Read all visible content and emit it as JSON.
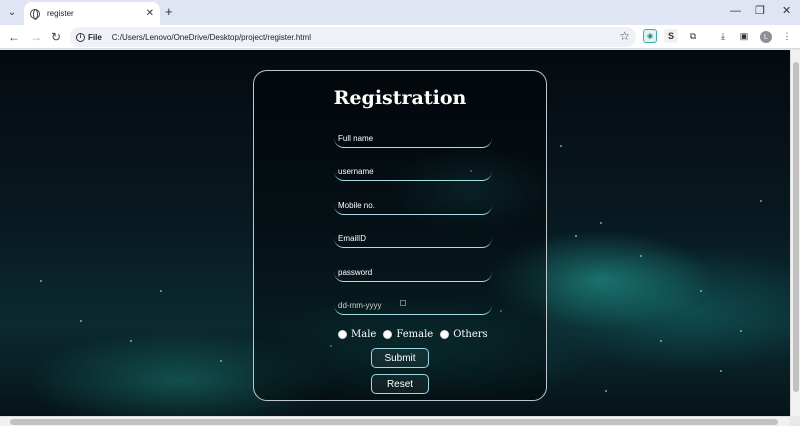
{
  "browser": {
    "tab_title": "register",
    "new_tab": "+",
    "url_chip": "File",
    "url": "C:/Users/Lenovo/OneDrive/Desktop/project/register.html",
    "avatar_letter": "L",
    "ext_s": "S"
  },
  "form": {
    "title": "Registration",
    "fields": {
      "full_name": "Full name",
      "username": "username",
      "mobile": "Mobile no.",
      "email": "EmailID",
      "password": "password",
      "dob": "dd-mm-yyyy"
    },
    "gender": [
      "Male",
      "Female",
      "Others"
    ],
    "submit": "Submit",
    "reset": "Reset"
  },
  "colors": {
    "accent_border": "#a8dfe8",
    "background_teal": "#0b2a30"
  }
}
